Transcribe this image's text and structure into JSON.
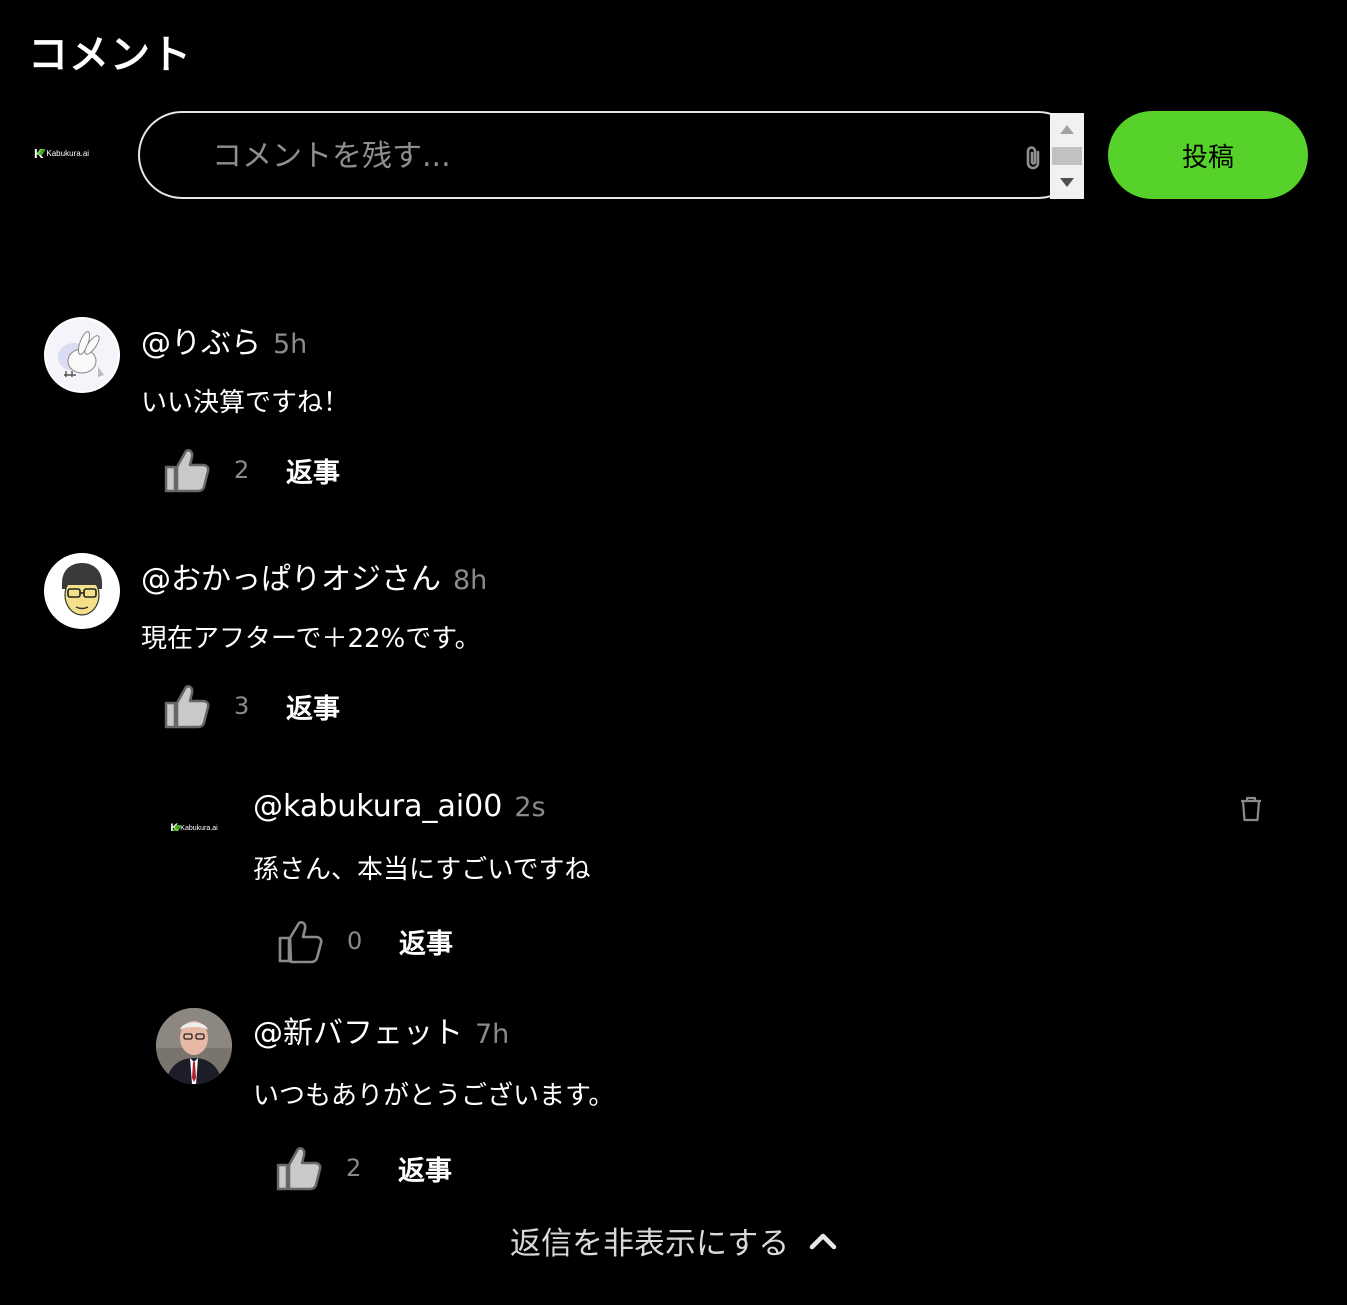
{
  "page": {
    "title": "コメント"
  },
  "composer": {
    "logo_text": "Kabukura.ai",
    "placeholder": "コメントを残す...",
    "submit_label": "投稿"
  },
  "comments": [
    {
      "username": "@りぶら",
      "ago": "5h",
      "text": "いい決算ですね！",
      "likes": "2",
      "reply_label": "返事"
    },
    {
      "username": "@おかっぱりオジさん",
      "ago": "8h",
      "text": "現在アフターで＋22%です。",
      "likes": "3",
      "reply_label": "返事"
    }
  ],
  "replies": [
    {
      "username": "@kabukura_ai00",
      "ago": "2s",
      "text": "孫さん、本当にすごいですね",
      "likes": "0",
      "reply_label": "返事",
      "logo_text": "Kabukura.ai"
    },
    {
      "username": "@新バフェット",
      "ago": "7h",
      "text": "いつもありがとうございます。",
      "likes": "2",
      "reply_label": "返事"
    }
  ],
  "hide_replies_label": "返信を非表示にする",
  "colors": {
    "accent": "#56d22b",
    "background": "#000000"
  }
}
